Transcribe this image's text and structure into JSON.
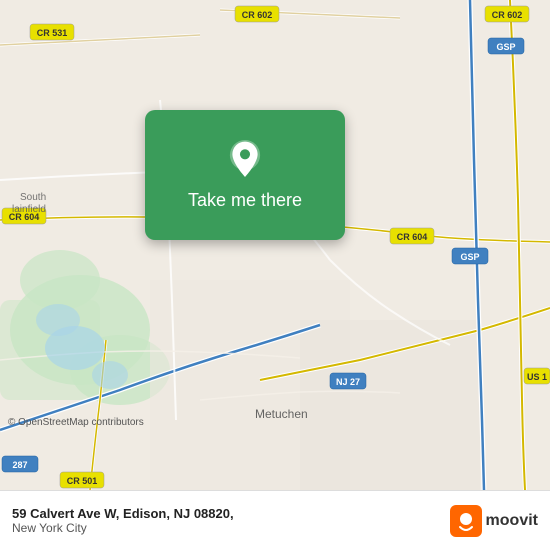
{
  "map": {
    "background_color": "#e8e0d8",
    "overlay_card": {
      "background_color": "#3a9c5a",
      "button_label": "Take me there"
    }
  },
  "bottom_bar": {
    "address_line1": "59 Calvert Ave W, Edison, NJ 08820,",
    "address_line2": "New York City",
    "osm_credit": "© OpenStreetMap contributors",
    "logo_text": "moovit"
  },
  "icons": {
    "map_pin": "location-pin-icon",
    "moovit": "moovit-logo-icon"
  }
}
